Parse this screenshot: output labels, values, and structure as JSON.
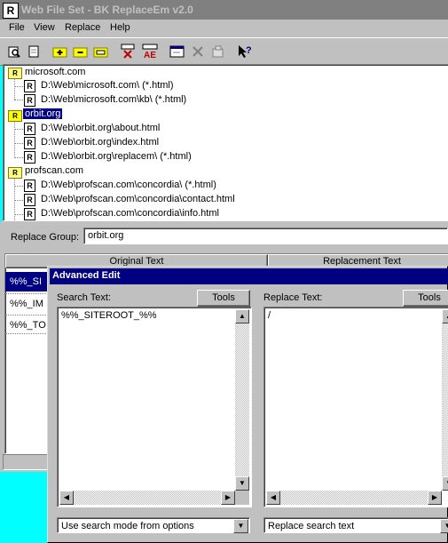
{
  "window": {
    "title": "Web File Set - BK ReplaceEm v2.0",
    "app_icon": "R"
  },
  "menu": [
    {
      "label": "File"
    },
    {
      "label": "View"
    },
    {
      "label": "Replace"
    },
    {
      "label": "Help"
    }
  ],
  "toolbar": {
    "icons": [
      "print-preview-icon",
      "new-document-icon",
      "add-group-icon",
      "remove-group-icon",
      "rename-group-icon",
      "delete-replace-icon",
      "replace-all-icon",
      "window-icon",
      "delete-icon",
      "properties-icon",
      "help-cursor-icon"
    ],
    "ae_label": "AE"
  },
  "tree": {
    "groups": [
      {
        "name": "microsoft.com",
        "items": [
          "D:\\Web\\microsoft.com\\ (*.html)",
          "D:\\Web\\microsoft.com\\kb\\ (*.html)"
        ]
      },
      {
        "name": "orbit.org",
        "items": [
          "D:\\Web\\orbit.org\\about.html",
          "D:\\Web\\orbit.org\\index.html",
          "D:\\Web\\orbit.org\\replacem\\ (*.html)"
        ]
      },
      {
        "name": "profscan.com",
        "items": [
          "D:\\Web\\profscan.com\\concordia\\ (*.html)",
          "D:\\Web\\profscan.com\\concordia\\contact.html",
          "D:\\Web\\profscan.com\\concordia\\info.html"
        ]
      }
    ]
  },
  "replace_group": {
    "label": "Replace Group:",
    "value": "orbit.org"
  },
  "grid": {
    "headers": [
      "Original Text",
      "Replacement Text"
    ],
    "rows": [
      "%%_SI",
      "%%_IM",
      "%%_TO"
    ]
  },
  "dialog": {
    "title": "Advanced Edit",
    "search_label": "Search Text:",
    "replace_label": "Replace Text:",
    "tools_label": "Tools",
    "search_value": "%%_SITEROOT_%%",
    "replace_value": "/",
    "search_mode": "Use search mode from options",
    "replace_mode": "Replace search text"
  }
}
